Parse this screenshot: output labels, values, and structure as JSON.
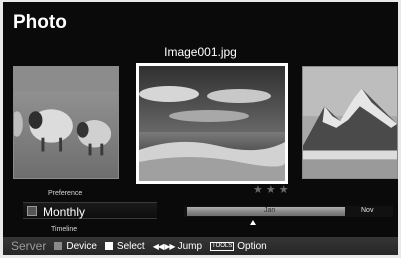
{
  "app": {
    "title": "Photo"
  },
  "viewer": {
    "filename": "Image001.jpg",
    "rating": "★★★"
  },
  "sort": {
    "previous": "Preference",
    "current": "Monthly",
    "next": "Timeline"
  },
  "timeline": {
    "highlight_label": "Jan",
    "end_label": "Nov"
  },
  "guide": {
    "server": "Server",
    "device": "Device",
    "select": "Select",
    "jump_icon": "◀◀ ▶▶",
    "jump": "Jump",
    "tools_badge": "TOOLS",
    "option": "Option"
  }
}
